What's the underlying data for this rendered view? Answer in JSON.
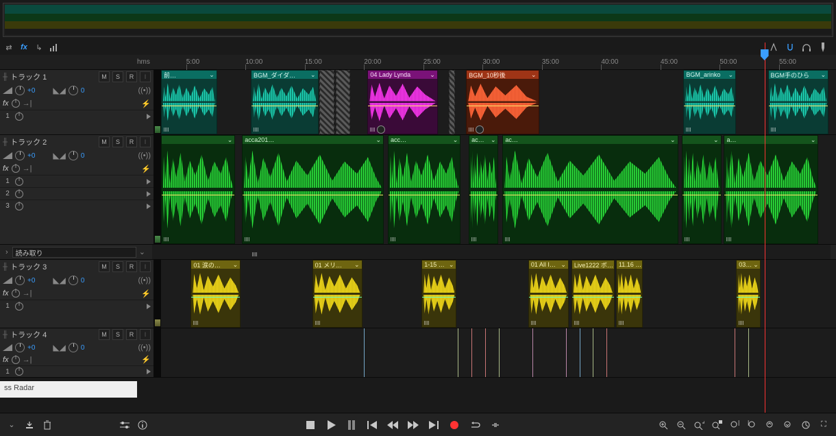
{
  "ruler": {
    "unit": "hms",
    "ticks": [
      "5:00",
      "10:00",
      "15:00",
      "20:00",
      "25:00",
      "30:00",
      "35:00",
      "40:00",
      "45:00",
      "50:00",
      "55:00"
    ]
  },
  "tracks": [
    {
      "name": "トラック 1",
      "color": "#1fd9bd",
      "mute": "M",
      "solo": "S",
      "rec": "R",
      "vol": "+0",
      "pan": "0",
      "fx": "fx",
      "sends": [
        "1"
      ],
      "clips": [
        {
          "label": "前…",
          "start": 0,
          "width": 8.3,
          "kind": "teal"
        },
        {
          "label": "BGM_ダイダ…",
          "start": 13.3,
          "width": 10.0,
          "kind": "teal"
        },
        {
          "label": "",
          "start": 23.5,
          "width": 2.2,
          "kind": "pattern"
        },
        {
          "label": "",
          "start": 25.9,
          "width": 2.1,
          "kind": "pattern"
        },
        {
          "label": "04 Lady Lynda",
          "start": 30.6,
          "width": 10.4,
          "kind": "pink"
        },
        {
          "label": "",
          "start": 42.6,
          "width": 1.0,
          "kind": "pattern"
        },
        {
          "label": "BGM_10秒後",
          "start": 45.2,
          "width": 10.8,
          "kind": "orange"
        },
        {
          "label": "BGM_arinko",
          "start": 77.4,
          "width": 7.8,
          "kind": "teal"
        },
        {
          "label": "BGM手のひら",
          "start": 89.9,
          "width": 9.0,
          "kind": "teal"
        }
      ]
    },
    {
      "name": "トラック 2",
      "color": "#2fe83f",
      "mute": "M",
      "solo": "S",
      "rec": "R",
      "vol": "+0",
      "pan": "0",
      "fx": "fx",
      "sends": [
        "1",
        "2",
        "3"
      ],
      "busLabel": "読み取り",
      "clips": [
        {
          "label": "",
          "start": 0,
          "width": 11.0,
          "kind": "green"
        },
        {
          "label": "acca201…",
          "start": 12.0,
          "width": 21.0,
          "kind": "green"
        },
        {
          "label": "acc…",
          "start": 33.6,
          "width": 10.8,
          "kind": "green"
        },
        {
          "label": "ac…",
          "start": 45.6,
          "width": 4.4,
          "kind": "green"
        },
        {
          "label": "ac…",
          "start": 50.6,
          "width": 26.0,
          "kind": "green"
        },
        {
          "label": "",
          "start": 77.2,
          "width": 5.8,
          "kind": "green"
        },
        {
          "label": "a…",
          "start": 83.4,
          "width": 14.0,
          "kind": "green"
        }
      ]
    },
    {
      "name": "トラック 3",
      "color": "#f5dd1a",
      "mute": "M",
      "solo": "S",
      "rec": "R",
      "vol": "+0",
      "pan": "0",
      "fx": "fx",
      "sends": [
        "1"
      ],
      "clips": [
        {
          "label": "01 涙の…",
          "start": 4.4,
          "width": 7.4,
          "kind": "yellow"
        },
        {
          "label": "01 メリ…",
          "start": 22.4,
          "width": 7.4,
          "kind": "yellow"
        },
        {
          "label": "1-15 …",
          "start": 38.6,
          "width": 5.2,
          "kind": "yellow"
        },
        {
          "label": "01 All I…",
          "start": 54.4,
          "width": 6.0,
          "kind": "yellow"
        },
        {
          "label": "Live1222 ボ…",
          "start": 60.8,
          "width": 6.4,
          "kind": "yellow"
        },
        {
          "label": "11.16 …",
          "start": 67.4,
          "width": 4.0,
          "kind": "yellow"
        },
        {
          "label": "03…",
          "start": 85.2,
          "width": 3.6,
          "kind": "yellow"
        }
      ]
    },
    {
      "name": "トラック 4",
      "color": "#8a7a20",
      "mute": "M",
      "solo": "S",
      "rec": "R",
      "vol": "+0",
      "pan": "0",
      "fx": "fx",
      "sends": [
        "1"
      ],
      "clips": []
    }
  ],
  "floatText": "ss Radar",
  "playheadPercent": 89.4
}
